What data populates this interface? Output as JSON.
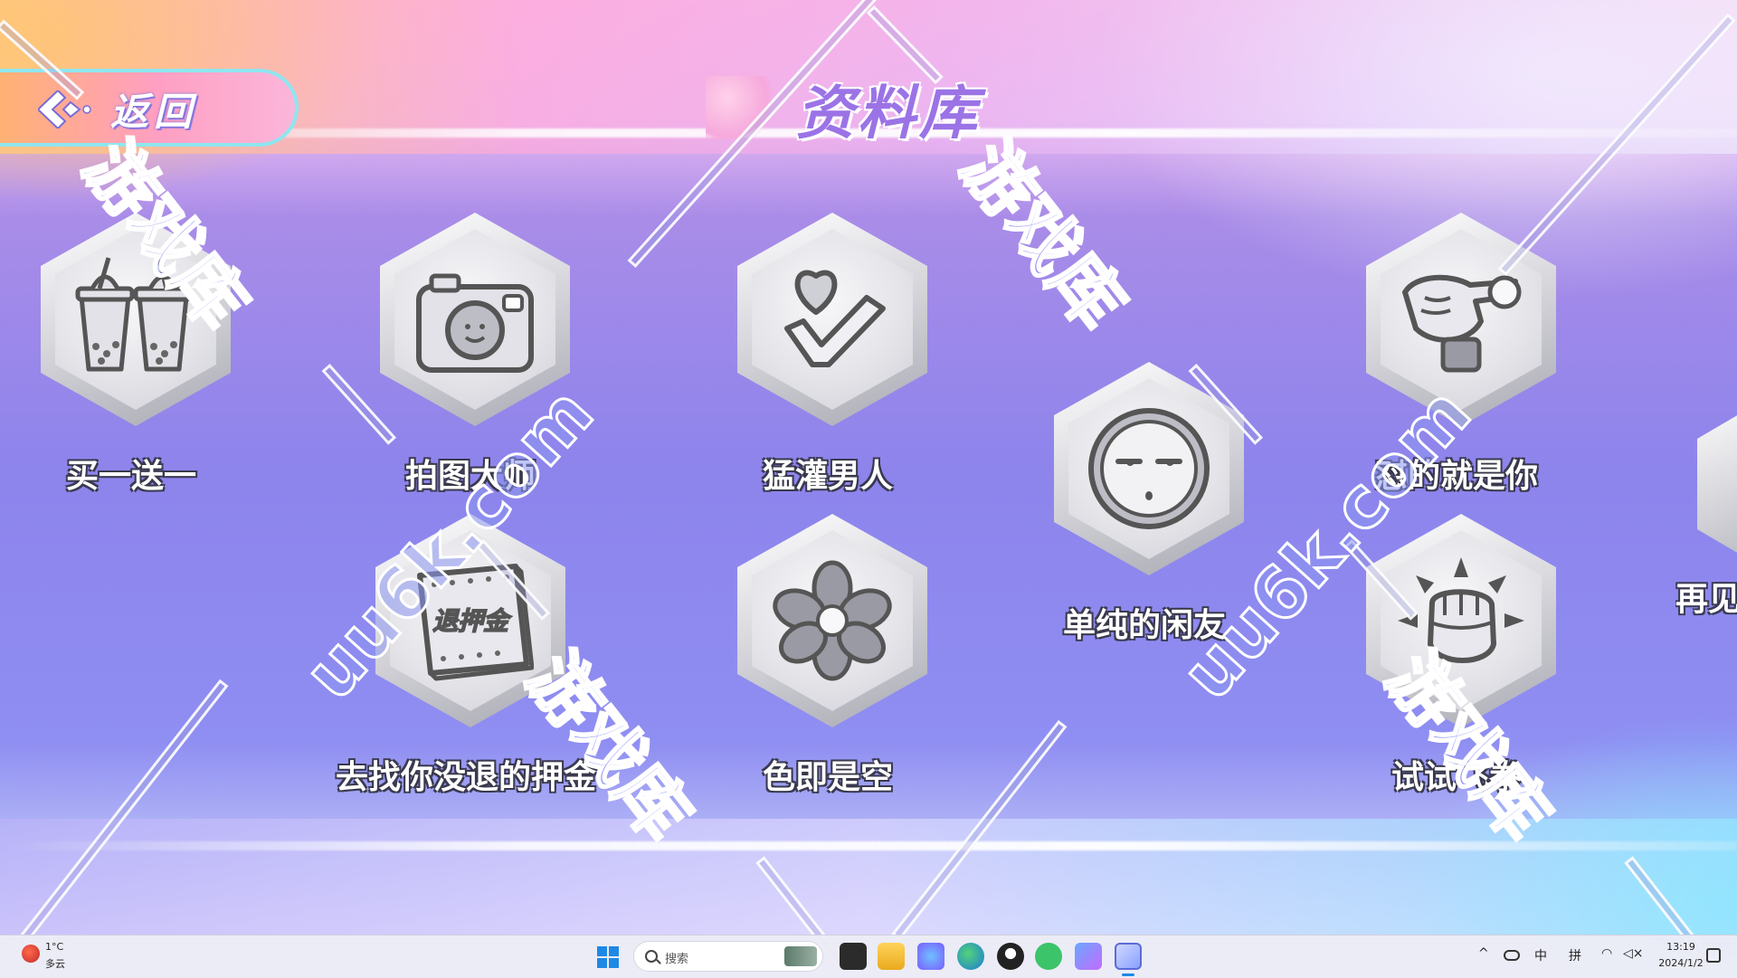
{
  "header": {
    "back_label": "返回",
    "title": "资料库"
  },
  "gallery": {
    "items": [
      {
        "label": "买一送一",
        "icon": "bubble-tea-cups-icon"
      },
      {
        "label": "拍图大师",
        "icon": "camera-icon"
      },
      {
        "label": "猛灌男人",
        "icon": "heart-check-icon"
      },
      {
        "label": "单纯的闲友",
        "icon": "bored-face-icon"
      },
      {
        "label": "怼的就是你",
        "icon": "pointing-hand-icon"
      },
      {
        "label": "去找你没退的押金",
        "icon": "deposit-notebook-icon",
        "icon_text": "退押金"
      },
      {
        "label": "色即是空",
        "icon": "flower-icon"
      },
      {
        "label": "试试飞拳",
        "icon": "fist-icon"
      }
    ],
    "partial_item": {
      "label": "再见",
      "icon": "partial-hex-icon"
    }
  },
  "watermark": {
    "texts": [
      "游戏库",
      "uu6k.com"
    ]
  },
  "taskbar": {
    "weather_temp": "1°C",
    "weather_desc": "多云",
    "search_placeholder": "搜索",
    "tray_lang_1": "中",
    "tray_lang_2": "拼",
    "time": "13:19",
    "date": "2024/1/2"
  },
  "colors": {
    "accent": "#9b73e6",
    "back_button": "#ff9fc2",
    "button_border": "#8fe6f0",
    "windows_blue": "#1e88e5"
  }
}
